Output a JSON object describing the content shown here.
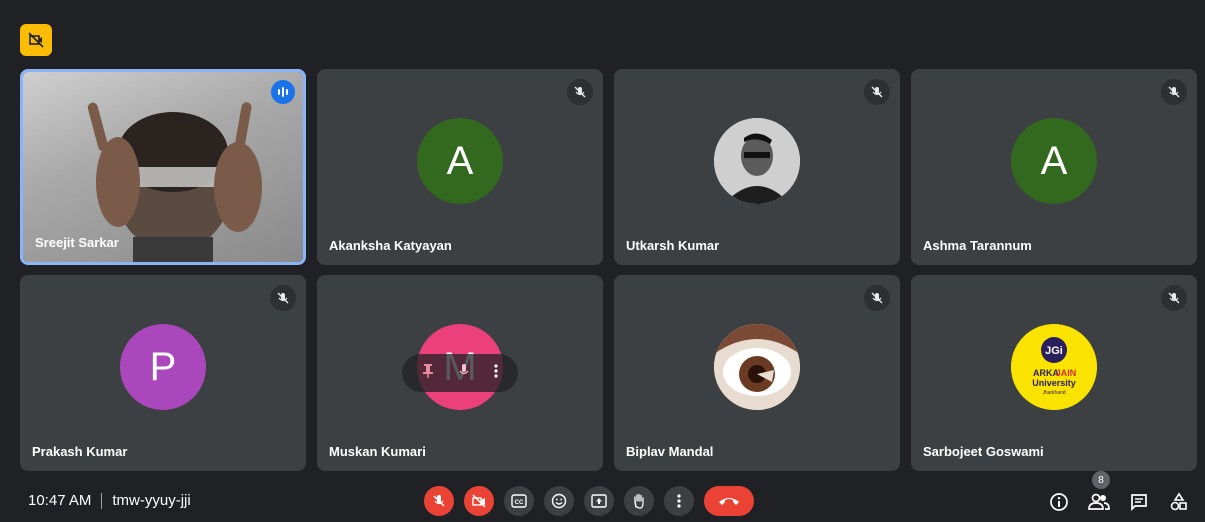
{
  "meeting": {
    "time": "10:47 AM",
    "code": "tmw-yyuy-jji",
    "participant_count": "8"
  },
  "participants": [
    {
      "name": "Sreejit Sarkar",
      "type": "video",
      "speaking": true
    },
    {
      "name": "Akanksha Katyayan",
      "type": "letter",
      "letter": "A",
      "color": "#33691e",
      "muted": true
    },
    {
      "name": "Utkarsh Kumar",
      "type": "photo",
      "muted": true
    },
    {
      "name": "Ashma Tarannum",
      "type": "letter",
      "letter": "A",
      "color": "#33691e",
      "muted": true
    },
    {
      "name": "Prakash Kumar",
      "type": "letter",
      "letter": "P",
      "color": "#ab47bc",
      "muted": true
    },
    {
      "name": "Muskan Kumari",
      "type": "letter",
      "letter": "M",
      "color": "#ec407a",
      "muted": false
    },
    {
      "name": "Biplav Mandal",
      "type": "photo",
      "muted": true
    },
    {
      "name": "Sarbojeet Goswami",
      "type": "logo",
      "muted": true,
      "logo": {
        "mark": "JGi",
        "line1a": "ARKA",
        "line1b": "JAIN",
        "line2": "University",
        "line3": "Jharkhand"
      }
    }
  ],
  "controls": [
    "mic-off",
    "camera-off",
    "captions",
    "emoji",
    "present",
    "raise-hand",
    "more-options",
    "leave-call"
  ],
  "right_controls": [
    "meeting-details",
    "people",
    "chat",
    "activities"
  ],
  "colors": {
    "background": "#202124",
    "tile": "#3c4043",
    "red": "#ea4335",
    "active_border": "#8ab4f8",
    "badge": "#fbbc04"
  }
}
